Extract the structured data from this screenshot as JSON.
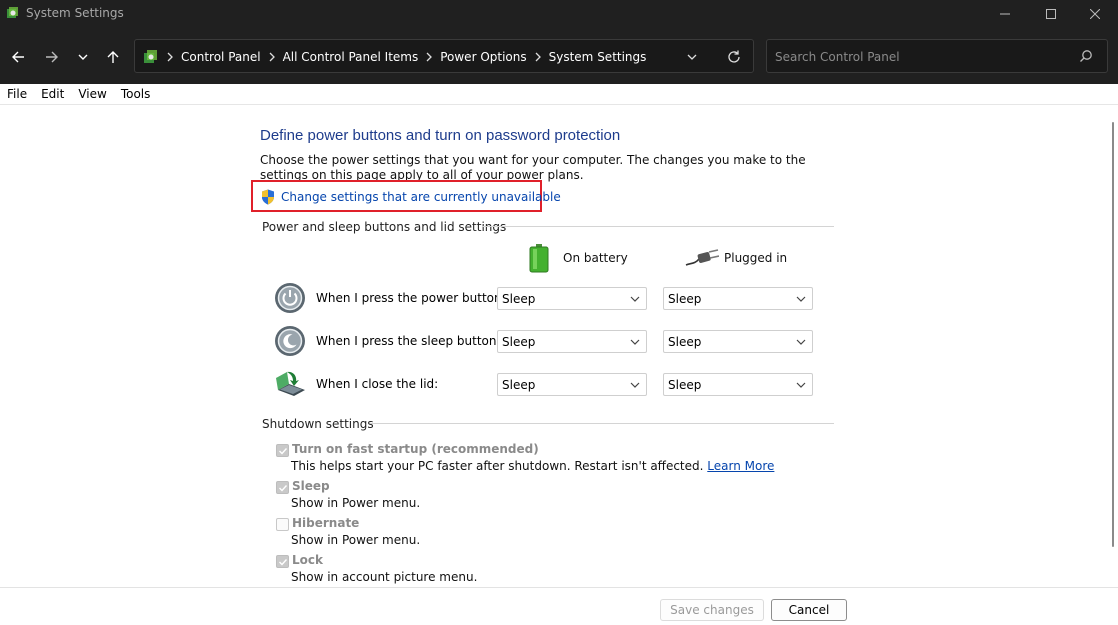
{
  "window": {
    "title": "System Settings",
    "controls": [
      "minimize",
      "maximize",
      "close"
    ]
  },
  "nav": {
    "breadcrumbs": [
      "Control Panel",
      "All Control Panel Items",
      "Power Options",
      "System Settings"
    ],
    "search_placeholder": "Search Control Panel"
  },
  "menu": [
    "File",
    "Edit",
    "View",
    "Tools"
  ],
  "page": {
    "heading": "Define power buttons and turn on password protection",
    "description": "Choose the power settings that you want for your computer. The changes you make to the settings on this page apply to all of your power plans.",
    "change_link": "Change settings that are currently unavailable"
  },
  "power_section": {
    "title": "Power and sleep buttons and lid settings",
    "col_battery": "On battery",
    "col_plugged": "Plugged in",
    "rows": [
      {
        "label": "When I press the power button:",
        "battery": "Sleep",
        "plugged": "Sleep",
        "icon": "power-button-icon"
      },
      {
        "label": "When I press the sleep button:",
        "battery": "Sleep",
        "plugged": "Sleep",
        "icon": "sleep-button-icon"
      },
      {
        "label": "When I close the lid:",
        "battery": "Sleep",
        "plugged": "Sleep",
        "icon": "laptop-lid-icon"
      }
    ]
  },
  "shutdown_section": {
    "title": "Shutdown settings",
    "items": [
      {
        "label": "Turn on fast startup (recommended)",
        "checked": true,
        "desc": "This helps start your PC faster after shutdown. Restart isn't affected.",
        "link": "Learn More"
      },
      {
        "label": "Sleep",
        "checked": true,
        "desc": "Show in Power menu."
      },
      {
        "label": "Hibernate",
        "checked": false,
        "desc": "Show in Power menu."
      },
      {
        "label": "Lock",
        "checked": true,
        "desc": "Show in account picture menu."
      }
    ]
  },
  "footer": {
    "save_label": "Save changes",
    "cancel_label": "Cancel"
  },
  "colors": {
    "heading": "#1e3c8c",
    "link": "#0645ad",
    "highlight_box": "#e0202a",
    "titlebar_bg": "#202020"
  }
}
